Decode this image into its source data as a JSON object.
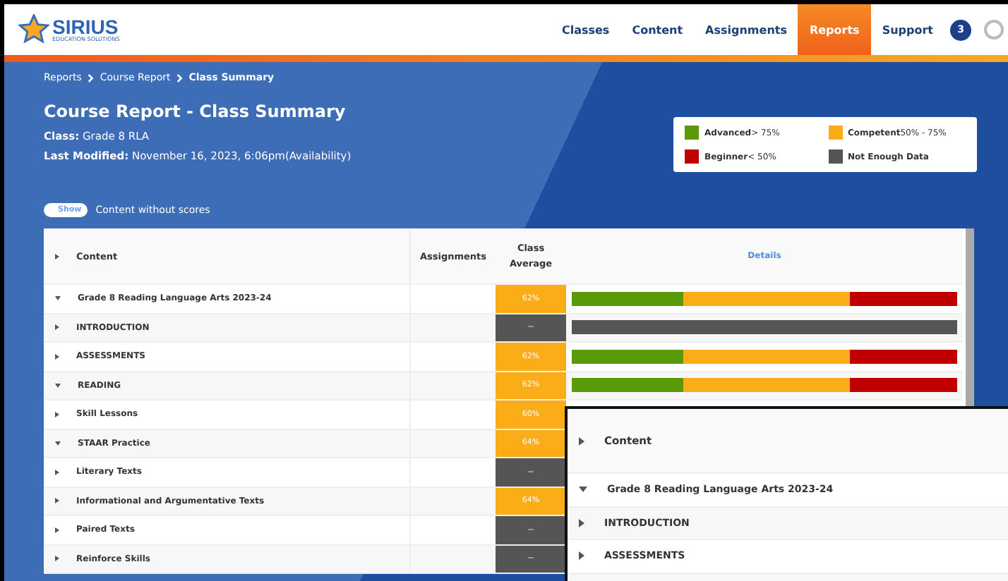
{
  "header": {
    "logo": {
      "name": "SIRIUS",
      "tagline": "EDUCATION SOLUTIONS"
    },
    "nav": [
      {
        "label": "Classes",
        "selected": false
      },
      {
        "label": "Content",
        "selected": false
      },
      {
        "label": "Assignments",
        "selected": false
      },
      {
        "label": "Reports",
        "selected": true
      },
      {
        "label": "Support",
        "selected": false
      }
    ],
    "badge": "3"
  },
  "breadcrumb": [
    {
      "label": "Reports",
      "current": false
    },
    {
      "label": "Course Report",
      "current": false
    },
    {
      "label": "Class Summary",
      "current": true
    }
  ],
  "title": "Course Report - Class Summary",
  "meta": [
    {
      "label": "Class:",
      "value": "Grade 8 RLA"
    },
    {
      "label": "Last Modified:",
      "value": "November 16, 2023, 6:06pm(Availability)"
    }
  ],
  "legend": [
    {
      "label": "Advanced",
      "range": "> 75%",
      "color": "#5a9a08"
    },
    {
      "label": "Competent",
      "range": "50% - 75%",
      "color": "#fbad18"
    },
    {
      "label": "Beginner",
      "range": "< 50%",
      "color": "#c00000"
    },
    {
      "label": "Not Enough Data",
      "color": "#555555"
    }
  ],
  "toggle": {
    "label": "Show",
    "on": false,
    "caption": "Content without scores"
  },
  "table": {
    "columns": [
      "Content",
      "Assignments",
      "Class Average",
      "Details"
    ],
    "rows": [
      {
        "name": "Grade 8 Reading Language Arts 2023-24",
        "expanded": true,
        "average": "62%",
        "color": "#fbad18",
        "segments": [
          {
            "level": 0.29,
            "color": "#5a9a08"
          },
          {
            "level": 0.72,
            "color": "#fbad18"
          },
          {
            "level": 1,
            "color": "#c00000"
          }
        ]
      },
      {
        "name": "INTRODUCTION",
        "expanded": false,
        "average": "--",
        "color": "#555555",
        "segments": [
          {
            "level": 1,
            "color": "#555555"
          }
        ]
      },
      {
        "name": "ASSESSMENTS",
        "expanded": false,
        "average": "62%",
        "color": "#fbad18",
        "segments": [
          {
            "level": 0.29,
            "color": "#5a9a08"
          },
          {
            "level": 0.72,
            "color": "#fbad18"
          },
          {
            "level": 1,
            "color": "#c00000"
          }
        ]
      },
      {
        "name": "READING",
        "expanded": true,
        "average": "62%",
        "color": "#fbad18",
        "segments": [
          {
            "level": 0.29,
            "color": "#5a9a08"
          },
          {
            "level": 0.72,
            "color": "#fbad18"
          },
          {
            "level": 1,
            "color": "#c00000"
          }
        ]
      },
      {
        "name": "Skill Lessons",
        "expanded": false,
        "average": "60%",
        "color": "#fbad18"
      },
      {
        "name": "STAAR Practice",
        "expanded": true,
        "average": "64%",
        "color": "#fbad18"
      },
      {
        "name": "Literary Texts",
        "expanded": false,
        "average": "--",
        "color": "#555555"
      },
      {
        "name": "Informational and Argumentative Texts",
        "expanded": false,
        "average": "64%",
        "color": "#fbad18"
      },
      {
        "name": "Paired Texts",
        "expanded": false,
        "average": "--",
        "color": "#555555"
      },
      {
        "name": "Reinforce Skills",
        "expanded": false,
        "average": "--",
        "color": "#555555"
      }
    ]
  },
  "zoom_inset": {
    "header": "Content",
    "rows": [
      {
        "name": "Grade 8 Reading Language Arts 2023-24",
        "expanded": true
      },
      {
        "name": "INTRODUCTION",
        "expanded": false
      },
      {
        "name": "ASSESSMENTS",
        "expanded": false
      }
    ]
  }
}
